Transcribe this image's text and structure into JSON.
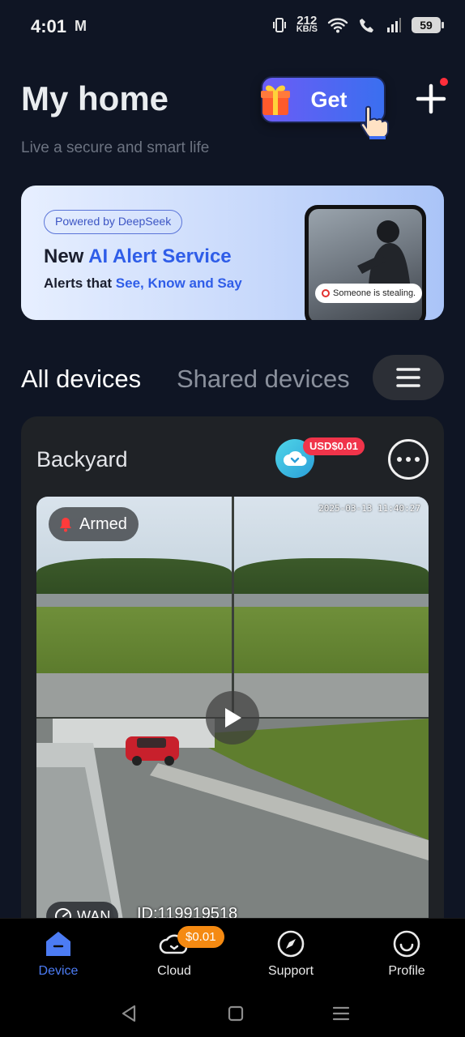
{
  "status_bar": {
    "time": "4:01",
    "mail_icon": "M",
    "speed_value": "212",
    "speed_unit": "KB/S",
    "battery": "59"
  },
  "header": {
    "title": "My home",
    "subtitle": "Live a secure and smart life",
    "get_label": "Get"
  },
  "banner": {
    "powered_by": "Powered by DeepSeek",
    "headline_prefix": "New ",
    "headline_accent": "AI Alert Service",
    "sub_prefix": "Alerts that ",
    "sub_accent": "See, Know and Say",
    "alert_chip": "Someone is stealing."
  },
  "tabs": {
    "all": "All devices",
    "shared": "Shared devices"
  },
  "device": {
    "name": "Backyard",
    "price_badge": "USD$0.01",
    "armed_label": "Armed",
    "timestamp": "2025-03-13 11:40:27",
    "connection": "WAN",
    "id_label": "ID:119919518"
  },
  "bottom_nav": {
    "items": [
      {
        "label": "Device",
        "icon": "home-icon"
      },
      {
        "label": "Cloud",
        "icon": "cloud-icon"
      },
      {
        "label": "Support",
        "icon": "compass-icon"
      },
      {
        "label": "Profile",
        "icon": "smile-icon"
      }
    ],
    "cloud_price": "$0.01"
  },
  "colors": {
    "accent": "#4c7cf4",
    "background": "#0f1524",
    "card": "#1f2226",
    "badge_red": "#f0344a",
    "badge_orange": "#f58a12"
  }
}
